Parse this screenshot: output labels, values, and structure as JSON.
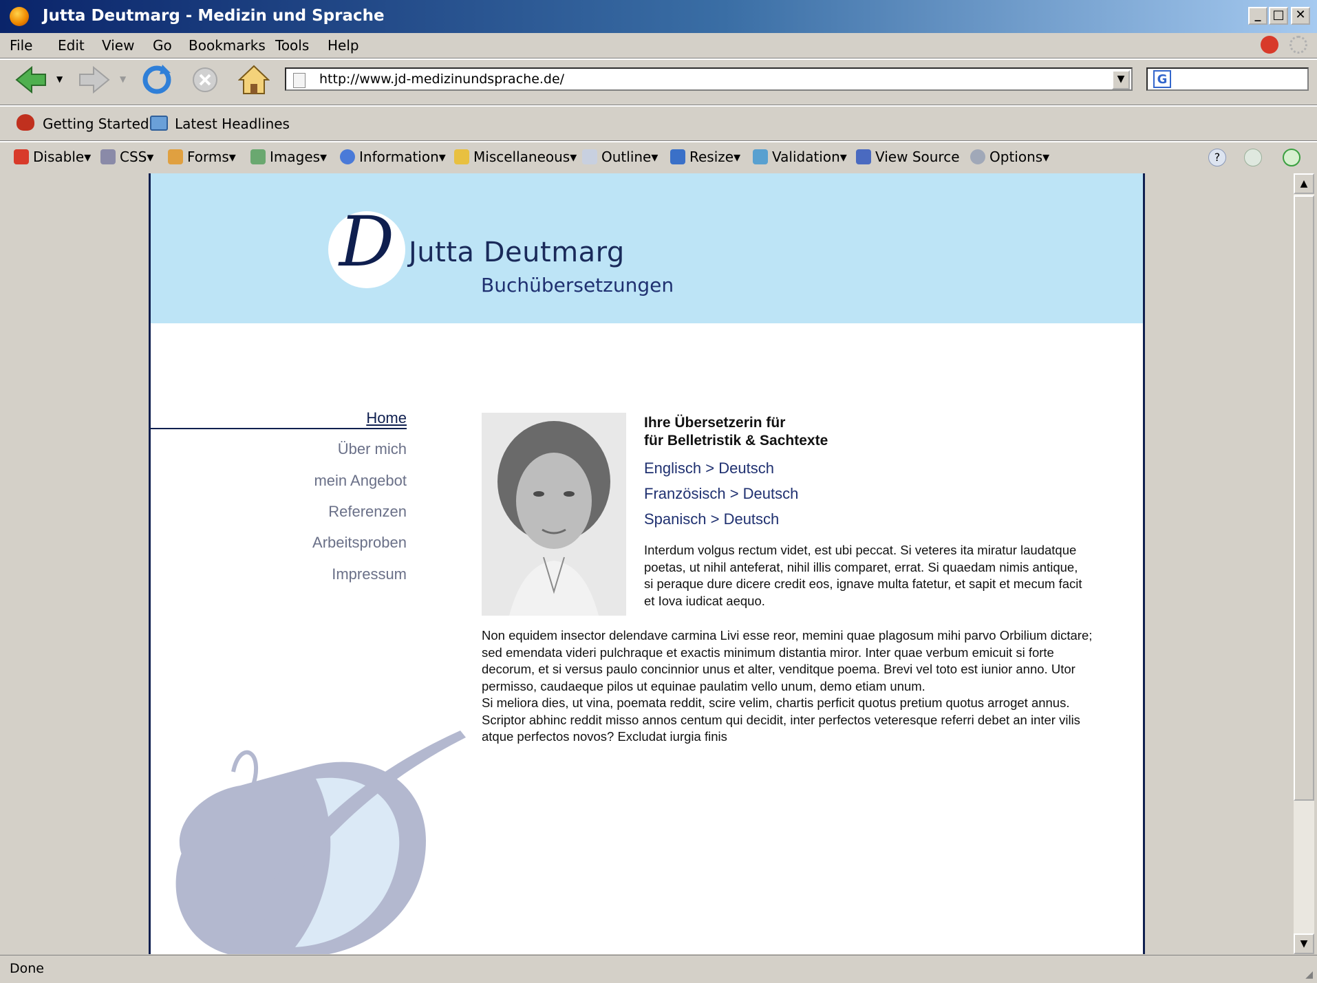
{
  "window": {
    "title": "Jutta Deutmarg - Medizin und Sprache",
    "min": "_",
    "max": "□",
    "close": "✕"
  },
  "menu": {
    "file": "File",
    "edit": "Edit",
    "view": "View",
    "go": "Go",
    "bookmarks": "Bookmarks",
    "tools": "Tools",
    "help": "Help"
  },
  "nav": {
    "url": "http://www.jd-medizinundsprache.de/",
    "dropdown": "▼",
    "search_engine": "G"
  },
  "bookmarks_bar": {
    "getting_started": "Getting Started",
    "latest_headlines": "Latest Headlines"
  },
  "dev_toolbar": {
    "disable": "Disable▾",
    "css": "CSS▾",
    "forms": "Forms▾",
    "images": "Images▾",
    "information": "Information▾",
    "miscellaneous": "Miscellaneous▾",
    "outline": "Outline▾",
    "resize": "Resize▾",
    "validation": "Validation▾",
    "view_source": "View Source",
    "options": "Options▾"
  },
  "site": {
    "logo_letter": "D",
    "name": "Jutta Deutmarg",
    "subtitle": "Buchübersetzungen",
    "nav_items": [
      "Home",
      "Über mich",
      "mein Angebot",
      "Referenzen",
      "Arbeitsproben",
      "Impressum"
    ],
    "heading_line1": "Ihre Übersetzerin für",
    "heading_line2": "für Belletristik & Sachtexte",
    "languages": [
      "Englisch > Deutsch",
      "Französisch > Deutsch",
      "Spanisch > Deutsch"
    ],
    "intro": "Interdum volgus rectum videt, est ubi peccat. Si veteres ita miratur laudatque poetas, ut nihil anteferat, nihil illis comparet, errat. Si quaedam nimis antique, si peraque dure dicere credit eos, ignave multa fatetur, et sapit et mecum facit et Iova iudicat aequo.",
    "body1": "Non equidem insector delendave carmina Livi esse reor, memini quae plagosum mihi parvo Orbilium dictare; sed emendata videri pulchraque et exactis minimum distantia miror. Inter quae verbum emicuit si forte decorum, et si versus paulo concinnior unus et alter, venditque poema. Brevi vel toto est iunior anno. Utor permisso, caudaeque pilos ut equinae paulatim vello unum, demo etiam unum.",
    "body2": "Si meliora dies, ut vina, poemata reddit, scire velim, chartis perficit quotus pretium quotus arroget annus. Scriptor abhinc reddit misso annos centum qui decidit, inter perfectos veteresque referri debet an inter vilis atque perfectos novos? Excludat iurgia finis"
  },
  "status": {
    "text": "Done"
  },
  "colors": {
    "header_band": "#bde4f6",
    "navy": "#0f1f4f",
    "nav_gray": "#6a7088",
    "big_d": "#b3b8cf"
  }
}
